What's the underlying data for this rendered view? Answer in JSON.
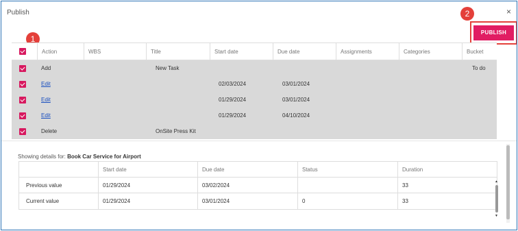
{
  "dialog": {
    "title": "Publish",
    "close_glyph": "×"
  },
  "publish_button": {
    "label": "PUBLISH"
  },
  "callouts": [
    "1",
    "2"
  ],
  "grid": {
    "columns": [
      "Action",
      "WBS",
      "Title",
      "Start date",
      "Due date",
      "Assignments",
      "Categories",
      "Bucket"
    ],
    "rows": [
      {
        "action": "Add",
        "wbs": "",
        "title": "New Task",
        "start": "",
        "due": "",
        "assign": "",
        "cat": "",
        "bucket": "To do"
      },
      {
        "action": "Edit",
        "wbs": "",
        "title": "",
        "start": "02/03/2024",
        "due": "03/01/2024",
        "assign": "",
        "cat": "",
        "bucket": ""
      },
      {
        "action": "Edit",
        "wbs": "",
        "title": "",
        "start": "01/29/2024",
        "due": "03/01/2024",
        "assign": "",
        "cat": "",
        "bucket": ""
      },
      {
        "action": "Edit",
        "wbs": "",
        "title": "",
        "start": "01/29/2024",
        "due": "04/10/2024",
        "assign": "",
        "cat": "",
        "bucket": ""
      },
      {
        "action": "Delete",
        "wbs": "",
        "title": "OnSite Press Kit",
        "start": "",
        "due": "",
        "assign": "",
        "cat": "",
        "bucket": ""
      }
    ]
  },
  "details": {
    "caption_prefix": "Showing details for:",
    "task_name": "Book Car Service for Airport",
    "columns": [
      "",
      "Start date",
      "Due date",
      "Status",
      "Duration"
    ],
    "rows": [
      [
        "Previous value",
        "01/29/2024",
        "03/02/2024",
        "",
        "33"
      ],
      [
        "Current value",
        "01/29/2024",
        "03/01/2024",
        "0",
        "33"
      ]
    ]
  },
  "colors": {
    "accent": "#e11d63",
    "checkbox": "#d7195f",
    "callout": "#e4403a",
    "link": "#1a4fbf"
  }
}
